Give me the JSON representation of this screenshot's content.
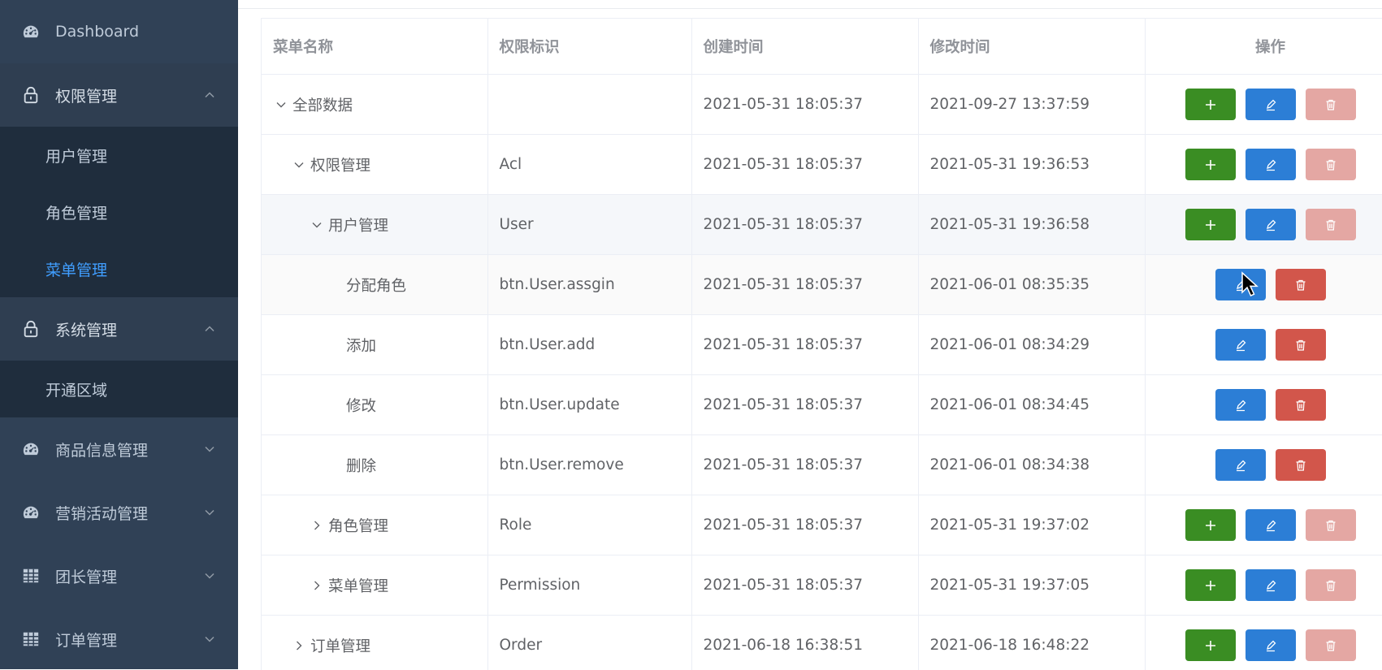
{
  "sidebar": {
    "items": [
      {
        "label": "Dashboard",
        "icon": "dashboard-icon"
      },
      {
        "label": "权限管理",
        "icon": "lock-icon",
        "expanded": true,
        "children": [
          {
            "label": "用户管理"
          },
          {
            "label": "角色管理"
          },
          {
            "label": "菜单管理",
            "active": true
          }
        ]
      },
      {
        "label": "系统管理",
        "icon": "lock-icon",
        "expanded": true,
        "children": [
          {
            "label": "开通区域"
          }
        ]
      },
      {
        "label": "商品信息管理",
        "icon": "dashboard-icon"
      },
      {
        "label": "营销活动管理",
        "icon": "dashboard-icon"
      },
      {
        "label": "团长管理",
        "icon": "table-icon"
      },
      {
        "label": "订单管理",
        "icon": "table-icon"
      }
    ]
  },
  "table": {
    "headers": {
      "name": "菜单名称",
      "code": "权限标识",
      "created": "创建时间",
      "modified": "修改时间",
      "ops": "操作"
    },
    "rows": [
      {
        "name": "全部数据",
        "code": "",
        "created": "2021-05-31 18:05:37",
        "modified": "2021-09-27 13:37:59"
      },
      {
        "name": "权限管理",
        "code": "Acl",
        "created": "2021-05-31 18:05:37",
        "modified": "2021-05-31 19:36:53"
      },
      {
        "name": "用户管理",
        "code": "User",
        "created": "2021-05-31 18:05:37",
        "modified": "2021-05-31 19:36:58"
      },
      {
        "name": "分配角色",
        "code": "btn.User.assgin",
        "created": "2021-05-31 18:05:37",
        "modified": "2021-06-01 08:35:35"
      },
      {
        "name": "添加",
        "code": "btn.User.add",
        "created": "2021-05-31 18:05:37",
        "modified": "2021-06-01 08:34:29"
      },
      {
        "name": "修改",
        "code": "btn.User.update",
        "created": "2021-05-31 18:05:37",
        "modified": "2021-06-01 08:34:45"
      },
      {
        "name": "删除",
        "code": "btn.User.remove",
        "created": "2021-05-31 18:05:37",
        "modified": "2021-06-01 08:34:38"
      },
      {
        "name": "角色管理",
        "code": "Role",
        "created": "2021-05-31 18:05:37",
        "modified": "2021-05-31 19:37:02"
      },
      {
        "name": "菜单管理",
        "code": "Permission",
        "created": "2021-05-31 18:05:37",
        "modified": "2021-05-31 19:37:05"
      },
      {
        "name": "订单管理",
        "code": "Order",
        "created": "2021-06-18 16:38:51",
        "modified": "2021-06-18 16:48:22"
      }
    ]
  },
  "colors": {
    "sidebar_bg": "#304156",
    "submenu_bg": "#1f2d3d",
    "active_link": "#409eff",
    "add_button": "#3a8d23",
    "edit_button": "#2c7ed6",
    "delete_button": "#d2564b",
    "delete_button_disabled": "#e4a7a3"
  }
}
